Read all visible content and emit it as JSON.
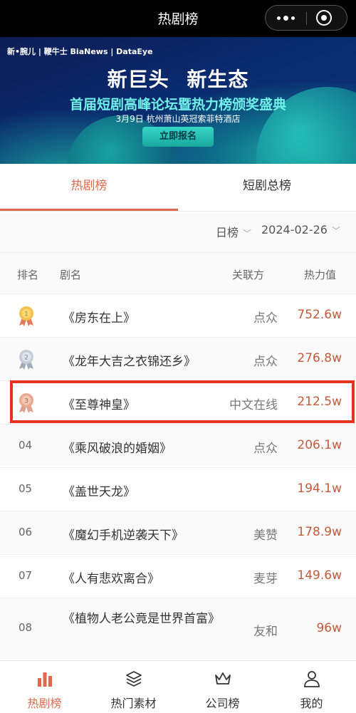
{
  "topbar": {
    "title": "热剧榜"
  },
  "banner": {
    "logos": "新•腕儿 | 鞭牛士 BiaNews | DataEye",
    "headline": "新巨头  新生态",
    "subtitle": "首届短剧高峰论坛暨热力榜颁奖盛典",
    "info": "3月9日 杭州萧山英冠索菲特酒店",
    "button": "立即报名"
  },
  "tabs": [
    "热剧榜",
    "短剧总榜"
  ],
  "filters": {
    "period": "日榜",
    "date": "2024-02-26"
  },
  "columns": {
    "rank": "排名",
    "name": "剧名",
    "party": "关联方",
    "heat": "热力值"
  },
  "rows": [
    {
      "rank": "",
      "medal": "gold",
      "name": "《房东在上》",
      "party": "点众",
      "heat": "752.6w"
    },
    {
      "rank": "",
      "medal": "silver",
      "name": "《龙年大吉之衣锦还乡》",
      "party": "点众",
      "heat": "276.8w"
    },
    {
      "rank": "",
      "medal": "bronze",
      "name": "《至尊神皇》",
      "party": "中文在线",
      "heat": "212.5w"
    },
    {
      "rank": "04",
      "name": "《乘风破浪的婚姻》",
      "party": "点众",
      "heat": "206.1w"
    },
    {
      "rank": "05",
      "name": "《盖世天龙》",
      "party": "",
      "heat": "194.1w"
    },
    {
      "rank": "06",
      "name": "《魔幻手机逆袭天下》",
      "party": "美赞",
      "heat": "178.9w"
    },
    {
      "rank": "07",
      "name": "《人有悲欢离合》",
      "party": "麦芽",
      "heat": "149.6w"
    },
    {
      "rank": "08",
      "name": "《植物人老公竟是世界首富》",
      "party": "友和",
      "heat": "96w"
    }
  ],
  "bottom_nav": [
    "热剧榜",
    "热门素材",
    "公司榜",
    "我的"
  ],
  "colors": {
    "accent": "#e0694d",
    "heat": "#c45a3b",
    "highlight": "#e8331e"
  }
}
